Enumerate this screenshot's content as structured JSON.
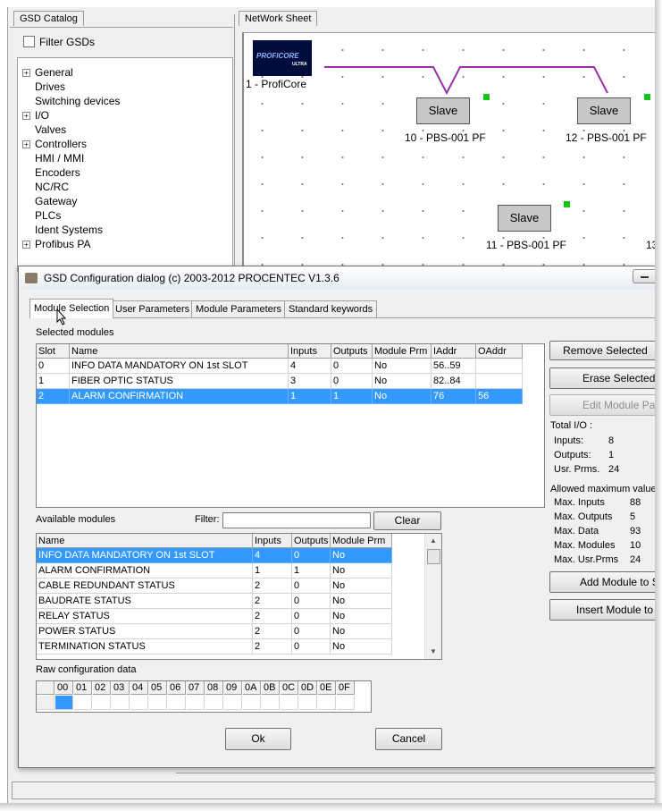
{
  "main": {
    "tabs": [
      {
        "label": "GSD Catalog"
      },
      {
        "label": "NetWork Sheet"
      }
    ],
    "filter_label": "Filter GSDs",
    "catalog_items": [
      {
        "label": "General",
        "expandable": true
      },
      {
        "label": "Drives",
        "expandable": false
      },
      {
        "label": "Switching devices",
        "expandable": false
      },
      {
        "label": "I/O",
        "expandable": true
      },
      {
        "label": "Valves",
        "expandable": false
      },
      {
        "label": "Controllers",
        "expandable": true
      },
      {
        "label": "HMI / MMI",
        "expandable": false
      },
      {
        "label": "Encoders",
        "expandable": false
      },
      {
        "label": "NC/RC",
        "expandable": false
      },
      {
        "label": "Gateway",
        "expandable": false
      },
      {
        "label": "PLCs",
        "expandable": false
      },
      {
        "label": "Ident Systems",
        "expandable": false
      },
      {
        "label": "Profibus PA",
        "expandable": true
      }
    ],
    "network": {
      "master_label": "1 - ProfiCore",
      "master_logo_text": "PROFICORE",
      "master_logo_sub": "ULTRA",
      "slave_text": "Slave",
      "slaves": [
        {
          "label": "10 - PBS-001 PF"
        },
        {
          "label": "12 - PBS-001 PF"
        },
        {
          "label": "11 - PBS-001 PF"
        },
        {
          "label": "13"
        }
      ],
      "bus_color": "#9b2fa8"
    }
  },
  "dialog": {
    "title": "GSD Configuration dialog (c) 2003-2012 PROCENTEC V1.3.6",
    "tabs": [
      {
        "label": "Module Selection",
        "active": true
      },
      {
        "label": "User Parameters"
      },
      {
        "label": "Module Parameters"
      },
      {
        "label": "Standard keywords"
      }
    ],
    "selected_modules": {
      "label": "Selected modules",
      "columns": [
        "Slot",
        "Name",
        "Inputs",
        "Outputs",
        "Module Prm",
        "IAddr",
        "OAddr"
      ],
      "rows": [
        [
          "0",
          "INFO DATA MANDATORY ON 1st SLOT",
          "4",
          "0",
          "No",
          "56..59",
          ""
        ],
        [
          "1",
          "FIBER OPTIC STATUS",
          "3",
          "0",
          "No",
          "82..84",
          ""
        ],
        [
          "2",
          "ALARM CONFIRMATION",
          "1",
          "1",
          "No",
          "76",
          "56"
        ]
      ],
      "selected_row": 2
    },
    "available_modules": {
      "label": "Available modules",
      "filter_label": "Filter:",
      "filter_value": "",
      "clear_label": "Clear",
      "columns": [
        "Name",
        "Inputs",
        "Outputs",
        "Module Prm"
      ],
      "rows": [
        [
          "INFO DATA MANDATORY ON 1st SLOT",
          "4",
          "0",
          "No"
        ],
        [
          "ALARM CONFIRMATION",
          "1",
          "1",
          "No"
        ],
        [
          "CABLE REDUNDANT STATUS",
          "2",
          "0",
          "No"
        ],
        [
          "BAUDRATE STATUS",
          "2",
          "0",
          "No"
        ],
        [
          "RELAY STATUS",
          "2",
          "0",
          "No"
        ],
        [
          "POWER STATUS",
          "2",
          "0",
          "No"
        ],
        [
          "TERMINATION STATUS",
          "2",
          "0",
          "No"
        ]
      ],
      "selected_row": 0
    },
    "raw": {
      "label": "Raw configuration data",
      "columns": [
        "00",
        "01",
        "02",
        "03",
        "04",
        "05",
        "06",
        "07",
        "08",
        "09",
        "0A",
        "0B",
        "0C",
        "0D",
        "0E",
        "0F"
      ]
    },
    "side_buttons": {
      "remove": "Remove Selected",
      "erase": "Erase Selected M",
      "edit": "Edit Module Paran",
      "add": "Add Module to Se",
      "insert": "Insert Module to Se"
    },
    "total_io": {
      "label": "Total I/O :",
      "items": [
        {
          "label": "Inputs:",
          "value": "8"
        },
        {
          "label": "Outputs:",
          "value": "1"
        },
        {
          "label": "Usr. Prms.",
          "value": "24"
        }
      ]
    },
    "allowed": {
      "label": "Allowed maximum values",
      "items": [
        {
          "label": "Max. Inputs",
          "value": "88"
        },
        {
          "label": "Max. Outputs",
          "value": "5"
        },
        {
          "label": "Max. Data",
          "value": "93"
        },
        {
          "label": "Max. Modules",
          "value": "10"
        },
        {
          "label": "Max. Usr.Prms",
          "value": "24"
        }
      ]
    },
    "ok_label": "Ok",
    "cancel_label": "Cancel"
  }
}
